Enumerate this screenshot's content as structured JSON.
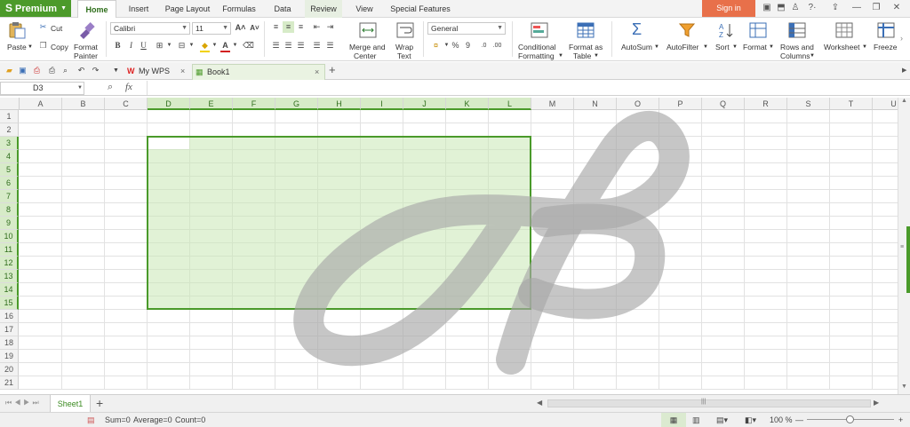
{
  "app": {
    "brand": "Premium",
    "menu_tabs": [
      "Home",
      "Insert",
      "Page Layout",
      "Formulas",
      "Data",
      "Review",
      "View",
      "Special Features"
    ],
    "active_tab": "Home",
    "sign_in": "Sign in",
    "accent_color": "#4c9a2a"
  },
  "ribbon": {
    "paste": "Paste",
    "cut": "Cut",
    "copy": "Copy",
    "format_painter_1": "Format",
    "format_painter_2": "Painter",
    "font_name": "Calibri",
    "font_size": "11",
    "bold": "B",
    "italic": "I",
    "underline": "U",
    "merge_1": "Merge and",
    "merge_2": "Center",
    "wrap_1": "Wrap",
    "wrap_2": "Text",
    "number_format": "General",
    "percent": "%",
    "thousands": "9",
    "cond_1": "Conditional",
    "cond_2": "Formatting",
    "table_1": "Format as",
    "table_2": "Table",
    "autosum": "AutoSum",
    "autofilter": "AutoFilter",
    "sort": "Sort",
    "format": "Format",
    "rows_1": "Rows and",
    "rows_2": "Columns",
    "worksheet": "Worksheet",
    "freeze": "Freeze P"
  },
  "doc_tabs": {
    "my_wps": "My WPS",
    "book": "Book1",
    "close": "×",
    "new": "+"
  },
  "formula_bar": {
    "cell_ref": "D3",
    "fx": "fx",
    "formula": ""
  },
  "grid": {
    "columns": [
      "A",
      "B",
      "C",
      "D",
      "E",
      "F",
      "G",
      "H",
      "I",
      "J",
      "K",
      "L",
      "M",
      "N",
      "O",
      "P",
      "Q",
      "R",
      "S",
      "T",
      "U"
    ],
    "rows": [
      "1",
      "2",
      "3",
      "4",
      "5",
      "6",
      "7",
      "8",
      "9",
      "10",
      "11",
      "12",
      "13",
      "14",
      "15",
      "16",
      "17",
      "18",
      "19",
      "20",
      "21"
    ],
    "selected_columns": [
      "D",
      "E",
      "F",
      "G",
      "H",
      "I",
      "J",
      "K",
      "L"
    ],
    "selected_rows": [
      "3",
      "4",
      "5",
      "6",
      "7",
      "8",
      "9",
      "10",
      "11",
      "12",
      "13",
      "14",
      "15"
    ],
    "selection_range": "D3:L15"
  },
  "sheets": {
    "tabs": [
      "Sheet1"
    ],
    "add": "+"
  },
  "status": {
    "sum": "Sum=0",
    "average": "Average=0",
    "count": "Count=0",
    "zoom": "100 %"
  }
}
